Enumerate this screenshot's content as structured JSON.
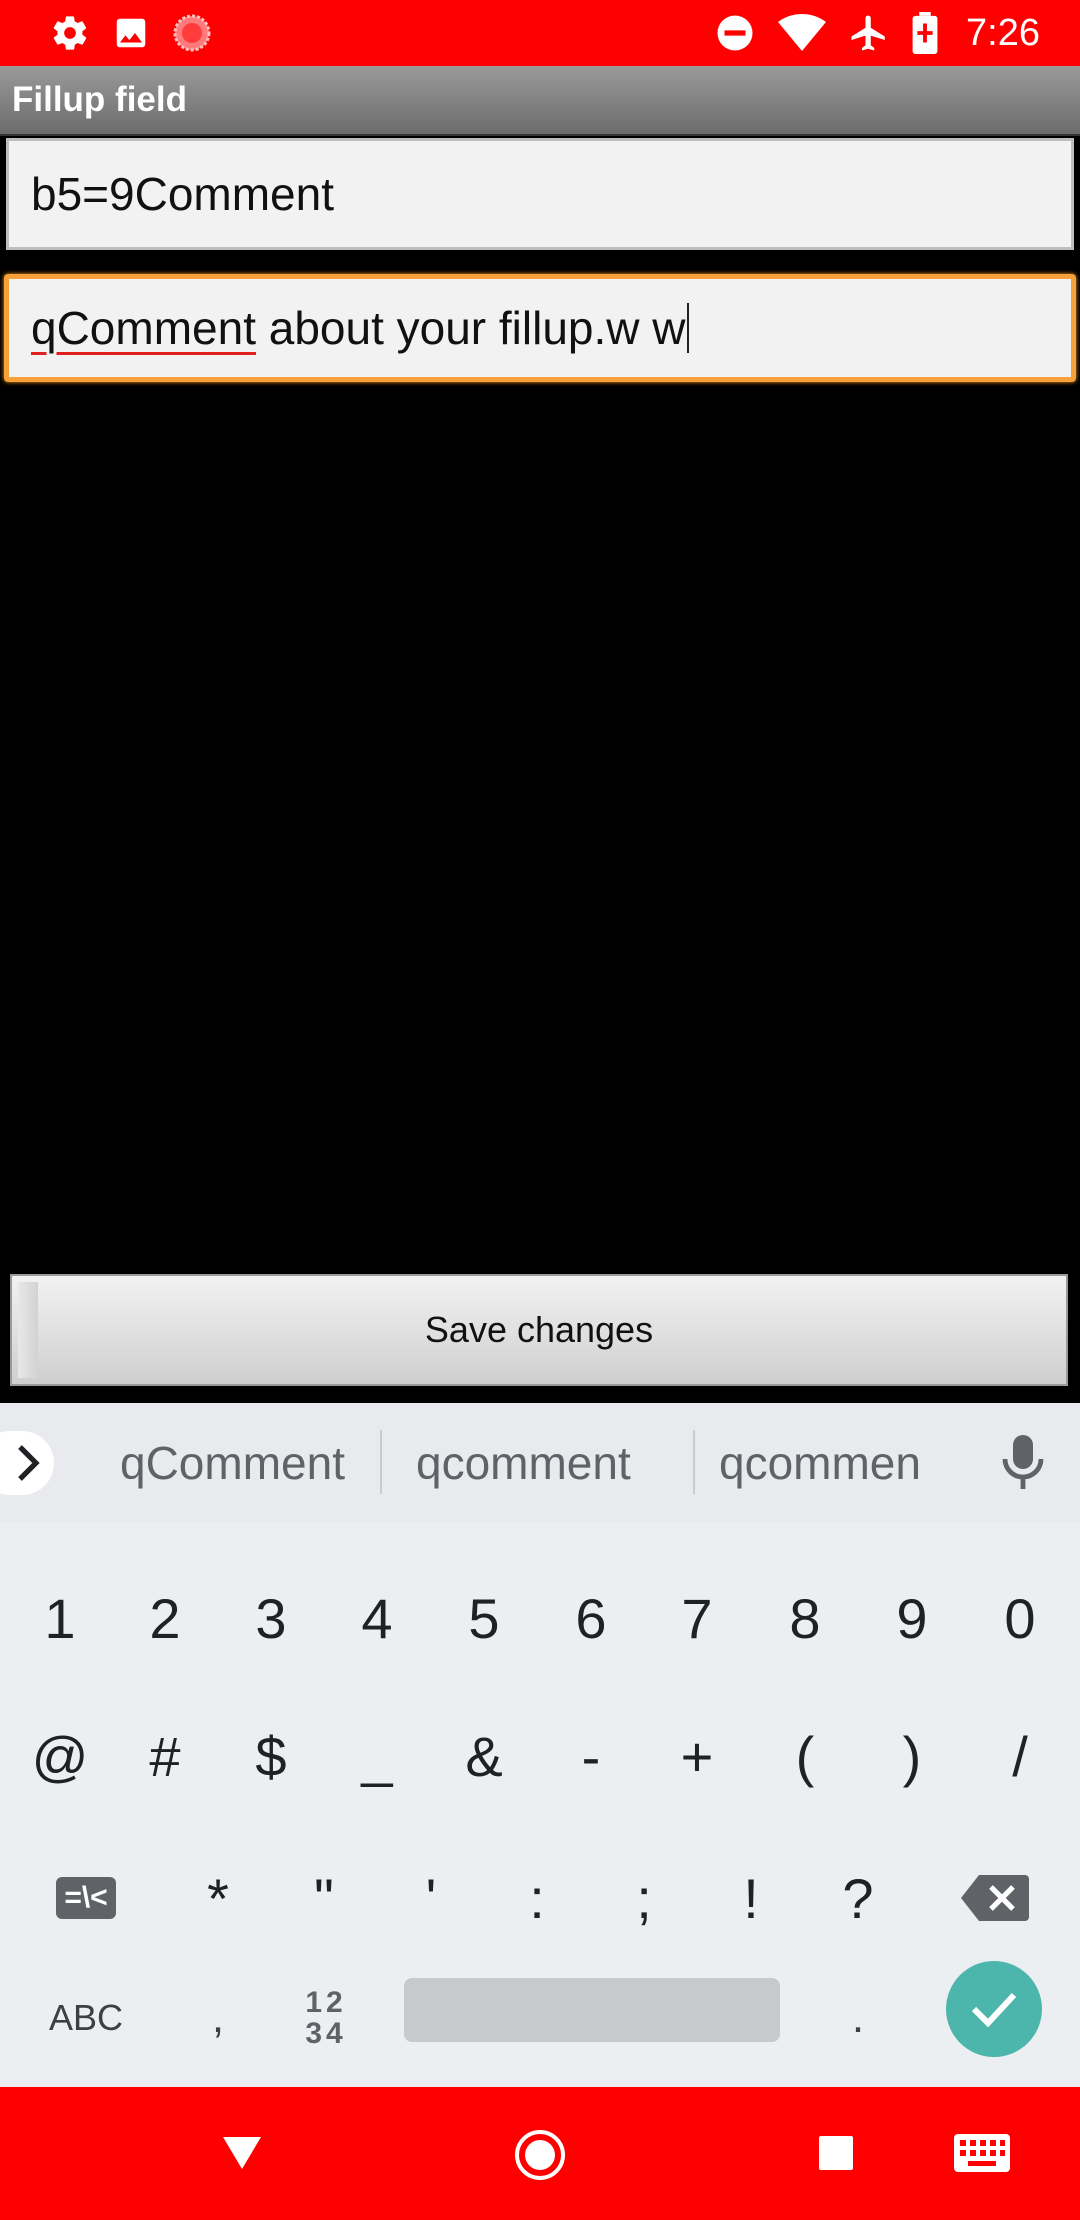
{
  "status_bar": {
    "time": "7:26",
    "left_icons": [
      "settings-icon",
      "gallery-icon",
      "recording-icon"
    ],
    "right_icons": [
      "do-not-disturb-icon",
      "wifi-icon",
      "airplane-mode-icon",
      "battery-charging-icon"
    ]
  },
  "app": {
    "title": "Fillup field",
    "field1": {
      "value": "b5=9Comment"
    },
    "field2": {
      "misspelled_word": "qComment",
      "value_rest": " about your fillup.w w"
    },
    "save_button": "Save changes"
  },
  "keyboard": {
    "suggestions": [
      "qComment",
      "qcomment",
      "qcommen"
    ],
    "rows": [
      [
        "1",
        "2",
        "3",
        "4",
        "5",
        "6",
        "7",
        "8",
        "9",
        "0"
      ],
      [
        "@",
        "#",
        "$",
        "_",
        "&",
        "-",
        "+",
        "(",
        ")",
        "/"
      ],
      [
        "*",
        "\"",
        "'",
        ":",
        ";",
        "!",
        "?"
      ]
    ],
    "more_symbols_key": "=\\<",
    "abc_key": "ABC",
    "comma_key": ",",
    "numpad_key_top": "12",
    "numpad_key_bottom": "34",
    "period_key": ".",
    "colors": {
      "enter_key": "#4db6ac",
      "background": "#eceff1"
    }
  },
  "nav_bar": {
    "buttons": [
      "back-icon",
      "home-icon",
      "recents-icon",
      "keyboard-icon"
    ],
    "color": "#ff0000"
  }
}
